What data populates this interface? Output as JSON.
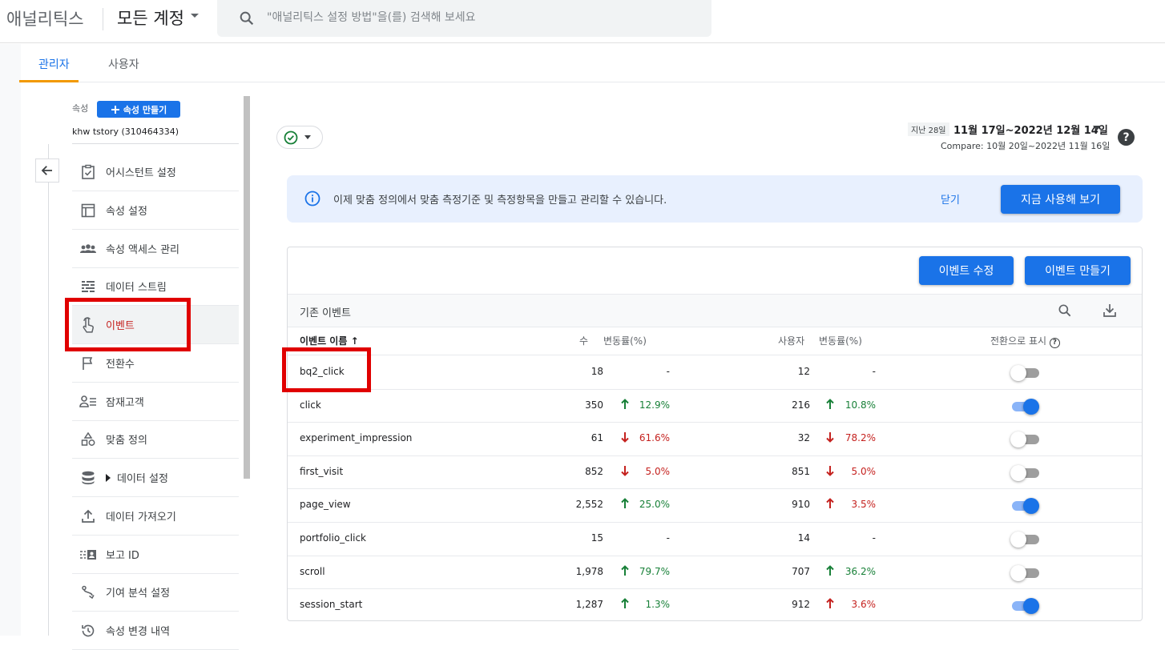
{
  "topbar": {
    "brand": "애널리틱스",
    "account": "모든 계정",
    "search_placeholder": "\"애널리틱스 설정 방법\"을(를) 검색해 보세요"
  },
  "tabs": [
    {
      "label": "관리자",
      "active": true
    },
    {
      "label": "사용자",
      "active": false
    }
  ],
  "sidebar": {
    "property_label": "속성",
    "create_property": "속성 만들기",
    "property_name": "khw tstory (310464334)",
    "items": [
      {
        "label": "어시스턴트 설정",
        "icon": "checklist-icon"
      },
      {
        "label": "속성 설정",
        "icon": "layout-icon"
      },
      {
        "label": "속성 액세스 관리",
        "icon": "people-icon"
      },
      {
        "label": "데이터 스트림",
        "icon": "data-stream-icon"
      },
      {
        "label": "이벤트",
        "icon": "touch-icon",
        "selected": true
      },
      {
        "label": "전환수",
        "icon": "flag-icon"
      },
      {
        "label": "잠재고객",
        "icon": "audience-icon"
      },
      {
        "label": "맞춤 정의",
        "icon": "shapes-icon"
      },
      {
        "label": "데이터 설정",
        "icon": "database-icon"
      },
      {
        "label": "데이터 가져오기",
        "icon": "upload-icon"
      },
      {
        "label": "보고 ID",
        "icon": "reporting-id-icon"
      },
      {
        "label": "기여 분석 설정",
        "icon": "attribution-icon"
      },
      {
        "label": "속성 변경 내역",
        "icon": "history-icon"
      }
    ]
  },
  "date": {
    "tag": "지난 28일",
    "range": "11월 17일~2022년 12월 14일",
    "compare": "Compare: 10월 20일~2022년 11월 16일"
  },
  "banner": {
    "text": "이제 맞춤 정의에서 맞춤 측정기준 및 측정항목을 만들고 관리할 수 있습니다.",
    "close": "닫기",
    "try": "지금 사용해 보기"
  },
  "events": {
    "edit_button": "이벤트 수정",
    "create_button": "이벤트 만들기",
    "section_title": "기존 이벤트",
    "headers": {
      "name": "이벤트 이름",
      "count": "수",
      "count_change": "변동률(%)",
      "users": "사용자",
      "users_change": "변동률(%)",
      "conversion": "전환으로 표시"
    },
    "rows": [
      {
        "name": "bq2_click",
        "count": "18",
        "count_change": "-",
        "count_dir": "none",
        "users": "12",
        "users_change": "-",
        "users_dir": "none",
        "conversion": false
      },
      {
        "name": "click",
        "count": "350",
        "count_change": "12.9%",
        "count_dir": "up",
        "users": "216",
        "users_change": "10.8%",
        "users_dir": "up",
        "conversion": true
      },
      {
        "name": "experiment_impression",
        "count": "61",
        "count_change": "61.6%",
        "count_dir": "down",
        "users": "32",
        "users_change": "78.2%",
        "users_dir": "down",
        "conversion": false
      },
      {
        "name": "first_visit",
        "count": "852",
        "count_change": "5.0%",
        "count_dir": "down",
        "users": "851",
        "users_change": "5.0%",
        "users_dir": "down",
        "conversion": false
      },
      {
        "name": "page_view",
        "count": "2,552",
        "count_change": "25.0%",
        "count_dir": "up",
        "users": "910",
        "users_change": "3.5%",
        "users_dir": "up-red",
        "conversion": true
      },
      {
        "name": "portfolio_click",
        "count": "15",
        "count_change": "-",
        "count_dir": "none",
        "users": "14",
        "users_change": "-",
        "users_dir": "none",
        "conversion": false
      },
      {
        "name": "scroll",
        "count": "1,978",
        "count_change": "79.7%",
        "count_dir": "up",
        "users": "707",
        "users_change": "36.2%",
        "users_dir": "up",
        "conversion": false
      },
      {
        "name": "session_start",
        "count": "1,287",
        "count_change": "1.3%",
        "count_dir": "up",
        "users": "912",
        "users_change": "3.6%",
        "users_dir": "up-red",
        "conversion": true
      }
    ]
  },
  "colors": {
    "accent": "#1a73e8",
    "tab_indicator": "#f29900",
    "up": "#188038",
    "down": "#c5221f",
    "highlight_box": "#e00000"
  }
}
